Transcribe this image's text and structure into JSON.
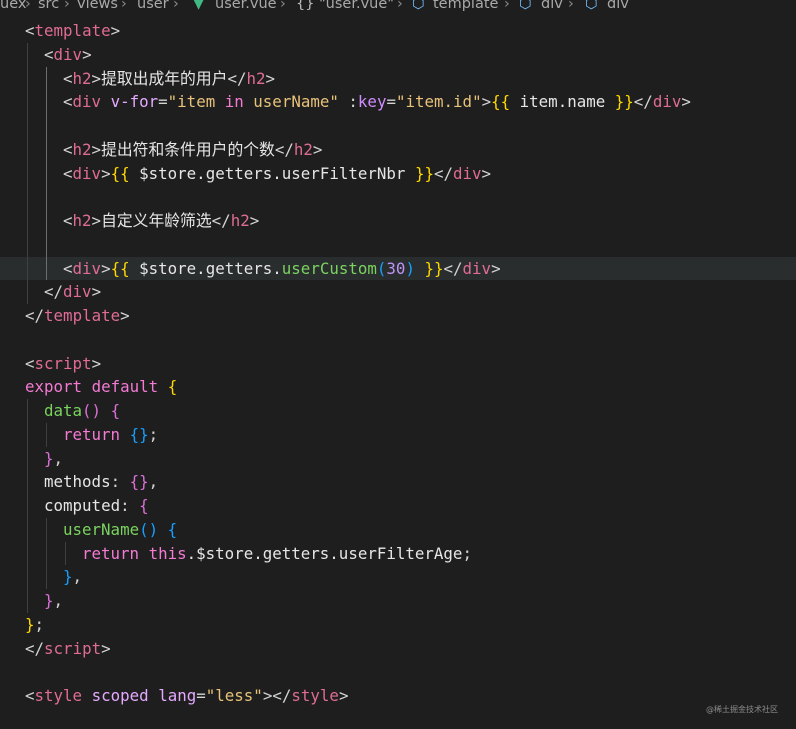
{
  "breadcrumb": {
    "items": [
      "uex",
      "src",
      "views",
      "user",
      "user.vue",
      "\"user.vue\"",
      "template",
      "div",
      "div"
    ],
    "separator": ">"
  },
  "code_lines": [
    [
      [
        "punct",
        "<"
      ],
      [
        "tag",
        "template"
      ],
      [
        "punct",
        ">"
      ]
    ],
    [
      [
        "punct",
        "<"
      ],
      [
        "tag",
        "div"
      ],
      [
        "punct",
        ">"
      ]
    ],
    [
      [
        "punct",
        "<"
      ],
      [
        "tag",
        "h2"
      ],
      [
        "punct",
        ">"
      ],
      [
        "text",
        "提取出成年的用户"
      ],
      [
        "punct",
        "</"
      ],
      [
        "tag",
        "h2"
      ],
      [
        "punct",
        ">"
      ]
    ],
    [
      [
        "punct",
        "<"
      ],
      [
        "tag",
        "div"
      ],
      [
        "punct",
        " "
      ],
      [
        "attr",
        "v-for"
      ],
      [
        "punct",
        "="
      ],
      [
        "str",
        "\"item"
      ],
      [
        "punct",
        " "
      ],
      [
        "kw",
        "in"
      ],
      [
        "punct",
        " "
      ],
      [
        "str",
        "userName\""
      ],
      [
        "punct",
        " :"
      ],
      [
        "attr2",
        "key"
      ],
      [
        "punct",
        "="
      ],
      [
        "str",
        "\"item.id\""
      ],
      [
        "punct",
        ">"
      ],
      [
        "brace",
        "{{"
      ],
      [
        "var",
        " item.name "
      ],
      [
        "brace",
        "}}"
      ],
      [
        "punct",
        "</"
      ],
      [
        "tag",
        "div"
      ],
      [
        "punct",
        ">"
      ]
    ],
    [],
    [
      [
        "punct",
        "<"
      ],
      [
        "tag",
        "h2"
      ],
      [
        "punct",
        ">"
      ],
      [
        "text",
        "提出符和条件用户的个数"
      ],
      [
        "punct",
        "</"
      ],
      [
        "tag",
        "h2"
      ],
      [
        "punct",
        ">"
      ]
    ],
    [
      [
        "punct",
        "<"
      ],
      [
        "tag",
        "div"
      ],
      [
        "punct",
        ">"
      ],
      [
        "brace",
        "{{"
      ],
      [
        "var",
        " $store.getters.userFilterNbr "
      ],
      [
        "brace",
        "}}"
      ],
      [
        "punct",
        "</"
      ],
      [
        "tag",
        "div"
      ],
      [
        "punct",
        ">"
      ]
    ],
    [],
    [
      [
        "punct",
        "<"
      ],
      [
        "tag",
        "h2"
      ],
      [
        "punct",
        ">"
      ],
      [
        "text",
        "自定义年龄筛选"
      ],
      [
        "punct",
        "</"
      ],
      [
        "tag",
        "h2"
      ],
      [
        "punct",
        ">"
      ]
    ],
    [],
    [
      [
        "punct",
        "<"
      ],
      [
        "tag",
        "div"
      ],
      [
        "punct",
        ">"
      ],
      [
        "brace",
        "{{"
      ],
      [
        "var",
        " $store.getters."
      ],
      [
        "fn",
        "userCustom"
      ],
      [
        "brace3",
        "("
      ],
      [
        "num",
        "30"
      ],
      [
        "brace3",
        ")"
      ],
      [
        "var",
        " "
      ],
      [
        "brace",
        "}}"
      ],
      [
        "punct",
        "</"
      ],
      [
        "tag",
        "div"
      ],
      [
        "punct",
        ">"
      ]
    ],
    [
      [
        "punct",
        "</"
      ],
      [
        "tag",
        "div"
      ],
      [
        "punct",
        ">"
      ]
    ],
    [
      [
        "punct",
        "</"
      ],
      [
        "tag",
        "template"
      ],
      [
        "punct",
        ">"
      ]
    ],
    [],
    [
      [
        "punct",
        "<"
      ],
      [
        "tag",
        "script"
      ],
      [
        "punct",
        ">"
      ]
    ],
    [
      [
        "kw",
        "export"
      ],
      [
        "punct",
        " "
      ],
      [
        "kw",
        "default"
      ],
      [
        "punct",
        " "
      ],
      [
        "brace",
        "{"
      ]
    ],
    [
      [
        "fn",
        "data"
      ],
      [
        "brace2",
        "()"
      ],
      [
        "punct",
        " "
      ],
      [
        "brace2",
        "{"
      ]
    ],
    [
      [
        "kw",
        "return"
      ],
      [
        "punct",
        " "
      ],
      [
        "brace3",
        "{}"
      ],
      [
        "punct",
        ";"
      ]
    ],
    [
      [
        "brace2",
        "}"
      ],
      [
        "punct",
        ","
      ]
    ],
    [
      [
        "var",
        "methods"
      ],
      [
        "punct",
        ": "
      ],
      [
        "brace2",
        "{}"
      ],
      [
        "punct",
        ","
      ]
    ],
    [
      [
        "var",
        "computed"
      ],
      [
        "punct",
        ": "
      ],
      [
        "brace2",
        "{"
      ]
    ],
    [
      [
        "fn",
        "userName"
      ],
      [
        "brace3",
        "()"
      ],
      [
        "punct",
        " "
      ],
      [
        "brace3",
        "{"
      ]
    ],
    [
      [
        "kw",
        "return"
      ],
      [
        "punct",
        " "
      ],
      [
        "kw",
        "this"
      ],
      [
        "var",
        ".$store.getters.userFilterAge"
      ],
      [
        "punct",
        ";"
      ]
    ],
    [
      [
        "brace3",
        "}"
      ],
      [
        "punct",
        ","
      ]
    ],
    [
      [
        "brace2",
        "}"
      ],
      [
        "punct",
        ","
      ]
    ],
    [
      [
        "brace",
        "}"
      ],
      [
        "punct",
        ";"
      ]
    ],
    [
      [
        "punct",
        "</"
      ],
      [
        "tag",
        "script"
      ],
      [
        "punct",
        ">"
      ]
    ],
    [],
    [
      [
        "punct",
        "<"
      ],
      [
        "tag",
        "style"
      ],
      [
        "punct",
        " "
      ],
      [
        "attr",
        "scoped"
      ],
      [
        "punct",
        " "
      ],
      [
        "attr",
        "lang"
      ],
      [
        "punct",
        "="
      ],
      [
        "str",
        "\"less\""
      ],
      [
        "punct",
        "></"
      ],
      [
        "tag",
        "style"
      ],
      [
        "punct",
        ">"
      ]
    ]
  ],
  "watermark": "@稀土掘金技术社区"
}
